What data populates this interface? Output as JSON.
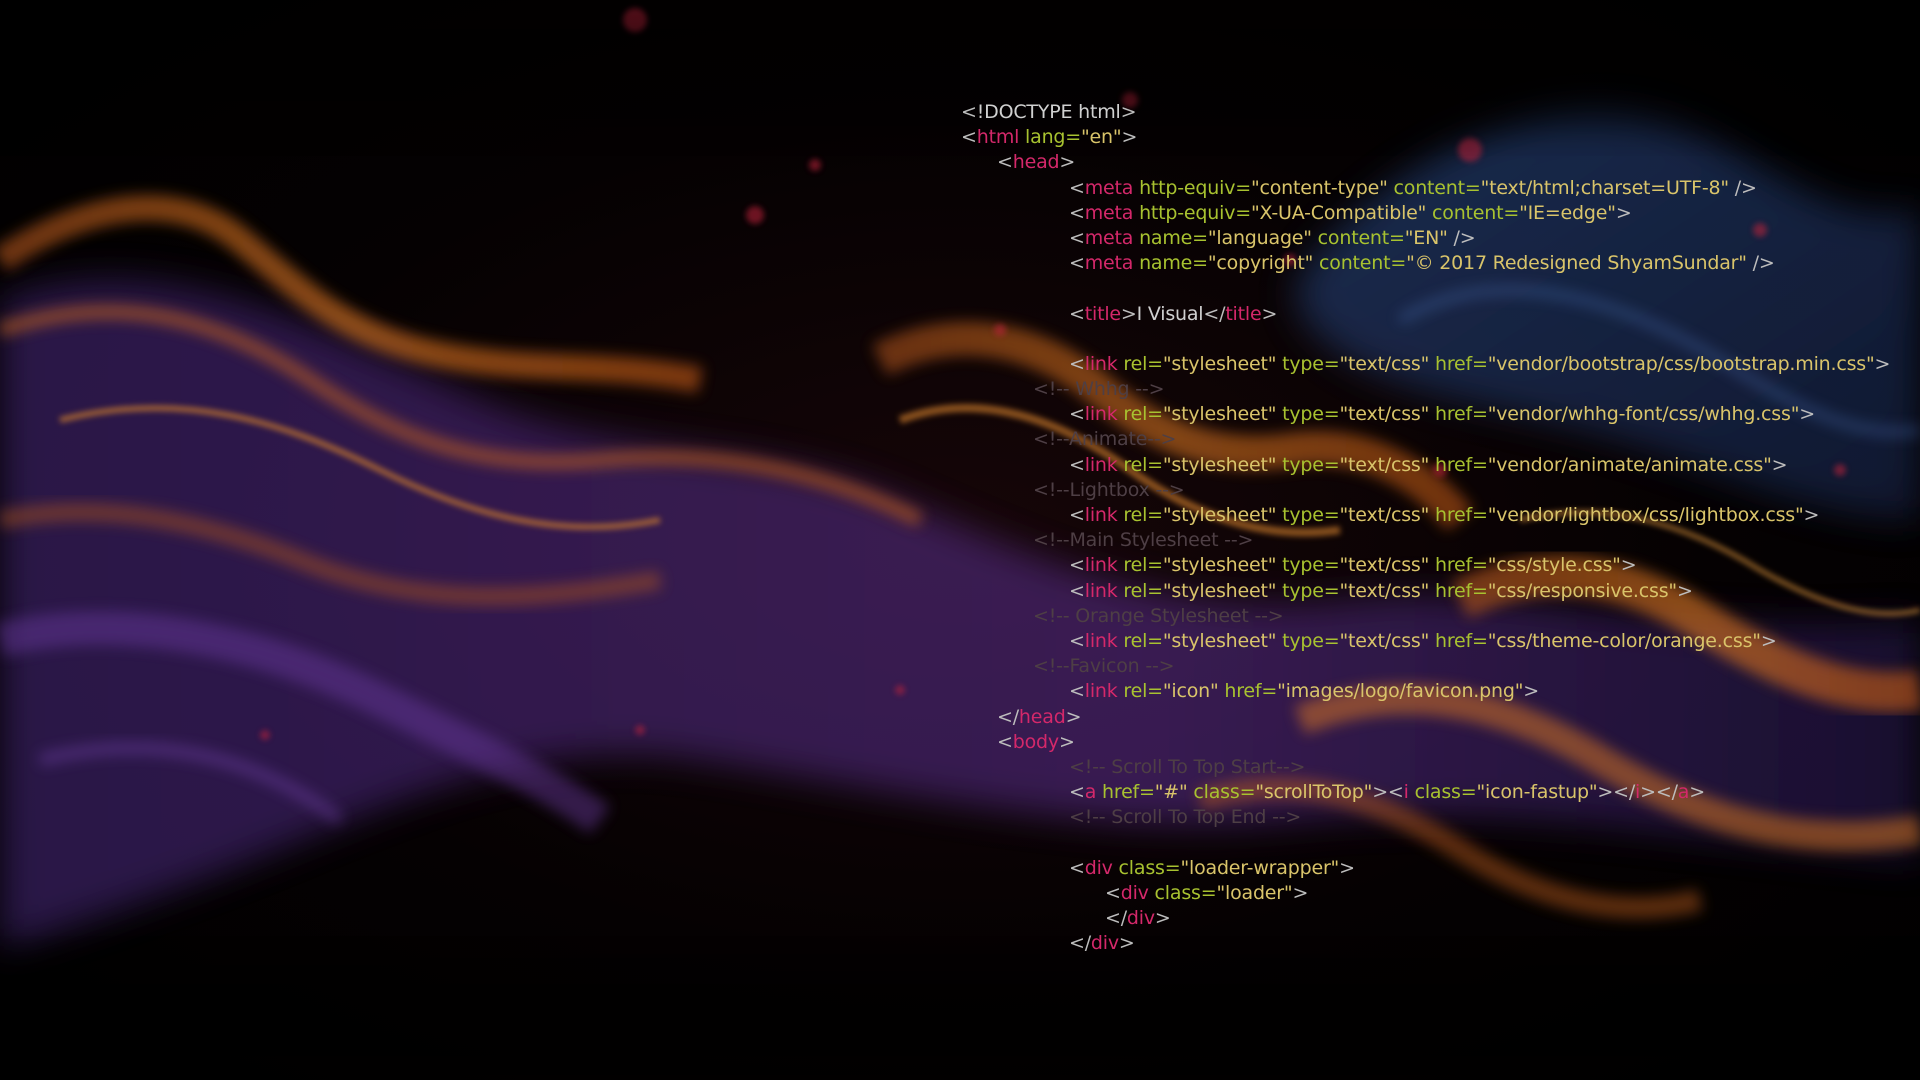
{
  "wallpaper": {
    "description_colors": {
      "background": "#000000",
      "flame_orange": "#e8731c",
      "flame_purple": "#5a2a8a",
      "smoke_blue": "#2c4a86",
      "ember_red": "#c0203a"
    }
  },
  "code": {
    "lines": [
      {
        "indent": 0,
        "tokens": [
          {
            "k": "bracket",
            "t": "<"
          },
          {
            "k": "text",
            "t": "!DOCTYPE html"
          },
          {
            "k": "bracket",
            "t": ">"
          }
        ]
      },
      {
        "indent": 0,
        "tokens": [
          {
            "k": "bracket",
            "t": "<"
          },
          {
            "k": "tag",
            "t": "html"
          },
          {
            "k": "attr",
            "t": " lang="
          },
          {
            "k": "value",
            "t": "\"en\""
          },
          {
            "k": "bracket",
            "t": ">"
          }
        ]
      },
      {
        "indent": 1,
        "tokens": [
          {
            "k": "bracket",
            "t": "<"
          },
          {
            "k": "tag",
            "t": "head"
          },
          {
            "k": "bracket",
            "t": ">"
          }
        ]
      },
      {
        "indent": 3,
        "tokens": [
          {
            "k": "bracket",
            "t": "<"
          },
          {
            "k": "tag",
            "t": "meta"
          },
          {
            "k": "attr",
            "t": " http-equiv="
          },
          {
            "k": "value",
            "t": "\"content-type\""
          },
          {
            "k": "attr",
            "t": " content="
          },
          {
            "k": "value",
            "t": "\"text/html;charset=UTF-8\""
          },
          {
            "k": "bracket",
            "t": " />"
          }
        ]
      },
      {
        "indent": 3,
        "tokens": [
          {
            "k": "bracket",
            "t": "<"
          },
          {
            "k": "tag",
            "t": "meta"
          },
          {
            "k": "attr",
            "t": " http-equiv="
          },
          {
            "k": "value",
            "t": "\"X-UA-Compatible\""
          },
          {
            "k": "attr",
            "t": " content="
          },
          {
            "k": "value",
            "t": "\"IE=edge\""
          },
          {
            "k": "bracket",
            "t": ">"
          }
        ]
      },
      {
        "indent": 3,
        "tokens": [
          {
            "k": "bracket",
            "t": "<"
          },
          {
            "k": "tag",
            "t": "meta"
          },
          {
            "k": "attr",
            "t": " name="
          },
          {
            "k": "value",
            "t": "\"language\""
          },
          {
            "k": "attr",
            "t": " content="
          },
          {
            "k": "value",
            "t": "\"EN\""
          },
          {
            "k": "bracket",
            "t": " />"
          }
        ]
      },
      {
        "indent": 3,
        "tokens": [
          {
            "k": "bracket",
            "t": "<"
          },
          {
            "k": "tag",
            "t": "meta"
          },
          {
            "k": "attr",
            "t": " name="
          },
          {
            "k": "value",
            "t": "\"copyright\""
          },
          {
            "k": "attr",
            "t": " content="
          },
          {
            "k": "value",
            "t": "\"© 2017 Redesigned ShyamSundar\""
          },
          {
            "k": "bracket",
            "t": " />"
          }
        ]
      },
      {
        "indent": 0,
        "tokens": []
      },
      {
        "indent": 3,
        "tokens": [
          {
            "k": "bracket",
            "t": "<"
          },
          {
            "k": "tag",
            "t": "title"
          },
          {
            "k": "bracket",
            "t": ">"
          },
          {
            "k": "text",
            "t": "I Visual"
          },
          {
            "k": "bracket",
            "t": "</"
          },
          {
            "k": "tag",
            "t": "title"
          },
          {
            "k": "bracket",
            "t": ">"
          }
        ]
      },
      {
        "indent": 0,
        "tokens": []
      },
      {
        "indent": 3,
        "tokens": [
          {
            "k": "bracket",
            "t": "<"
          },
          {
            "k": "tag",
            "t": "link"
          },
          {
            "k": "attr",
            "t": " rel="
          },
          {
            "k": "value",
            "t": "\"stylesheet\""
          },
          {
            "k": "attr",
            "t": " type="
          },
          {
            "k": "value",
            "t": "\"text/css\""
          },
          {
            "k": "attr",
            "t": " href="
          },
          {
            "k": "value",
            "t": "\"vendor/bootstrap/css/bootstrap.min.css\""
          },
          {
            "k": "bracket",
            "t": ">"
          }
        ]
      },
      {
        "indent": 2,
        "tokens": [
          {
            "k": "comment",
            "t": "<!-- Whhg -->"
          }
        ]
      },
      {
        "indent": 3,
        "tokens": [
          {
            "k": "bracket",
            "t": "<"
          },
          {
            "k": "tag",
            "t": "link"
          },
          {
            "k": "attr",
            "t": " rel="
          },
          {
            "k": "value",
            "t": "\"stylesheet\""
          },
          {
            "k": "attr",
            "t": " type="
          },
          {
            "k": "value",
            "t": "\"text/css\""
          },
          {
            "k": "attr",
            "t": " href="
          },
          {
            "k": "value",
            "t": "\"vendor/whhg-font/css/whhg.css\""
          },
          {
            "k": "bracket",
            "t": ">"
          }
        ]
      },
      {
        "indent": 2,
        "tokens": [
          {
            "k": "comment",
            "t": "<!--Animate-->"
          }
        ]
      },
      {
        "indent": 3,
        "tokens": [
          {
            "k": "bracket",
            "t": "<"
          },
          {
            "k": "tag",
            "t": "link"
          },
          {
            "k": "attr",
            "t": " rel="
          },
          {
            "k": "value",
            "t": "\"stylesheet\""
          },
          {
            "k": "attr",
            "t": " type="
          },
          {
            "k": "value",
            "t": "\"text/css\""
          },
          {
            "k": "attr",
            "t": " href="
          },
          {
            "k": "value",
            "t": "\"vendor/animate/animate.css\""
          },
          {
            "k": "bracket",
            "t": ">"
          }
        ]
      },
      {
        "indent": 2,
        "tokens": [
          {
            "k": "comment",
            "t": "<!--Lightbox -->"
          }
        ]
      },
      {
        "indent": 3,
        "tokens": [
          {
            "k": "bracket",
            "t": "<"
          },
          {
            "k": "tag",
            "t": "link"
          },
          {
            "k": "attr",
            "t": " rel="
          },
          {
            "k": "value",
            "t": "\"stylesheet\""
          },
          {
            "k": "attr",
            "t": " type="
          },
          {
            "k": "value",
            "t": "\"text/css\""
          },
          {
            "k": "attr",
            "t": " href="
          },
          {
            "k": "value",
            "t": "\"vendor/lightbox/css/lightbox.css\""
          },
          {
            "k": "bracket",
            "t": ">"
          }
        ]
      },
      {
        "indent": 2,
        "tokens": [
          {
            "k": "comment",
            "t": "<!--Main Stylesheet -->"
          }
        ]
      },
      {
        "indent": 3,
        "tokens": [
          {
            "k": "bracket",
            "t": "<"
          },
          {
            "k": "tag",
            "t": "link"
          },
          {
            "k": "attr",
            "t": " rel="
          },
          {
            "k": "value",
            "t": "\"stylesheet\""
          },
          {
            "k": "attr",
            "t": " type="
          },
          {
            "k": "value",
            "t": "\"text/css\""
          },
          {
            "k": "attr",
            "t": " href="
          },
          {
            "k": "value",
            "t": "\"css/style.css\""
          },
          {
            "k": "bracket",
            "t": ">"
          }
        ]
      },
      {
        "indent": 3,
        "tokens": [
          {
            "k": "bracket",
            "t": "<"
          },
          {
            "k": "tag",
            "t": "link"
          },
          {
            "k": "attr",
            "t": " rel="
          },
          {
            "k": "value",
            "t": "\"stylesheet\""
          },
          {
            "k": "attr",
            "t": " type="
          },
          {
            "k": "value",
            "t": "\"text/css\""
          },
          {
            "k": "attr",
            "t": " href="
          },
          {
            "k": "value",
            "t": "\"css/responsive.css\""
          },
          {
            "k": "bracket",
            "t": ">"
          }
        ]
      },
      {
        "indent": 2,
        "tokens": [
          {
            "k": "comment",
            "t": "<!-- Orange Stylesheet -->"
          }
        ]
      },
      {
        "indent": 3,
        "tokens": [
          {
            "k": "bracket",
            "t": "<"
          },
          {
            "k": "tag",
            "t": "link"
          },
          {
            "k": "attr",
            "t": " rel="
          },
          {
            "k": "value",
            "t": "\"stylesheet\""
          },
          {
            "k": "attr",
            "t": " type="
          },
          {
            "k": "value",
            "t": "\"text/css\""
          },
          {
            "k": "attr",
            "t": " href="
          },
          {
            "k": "value",
            "t": "\"css/theme-color/orange.css\""
          },
          {
            "k": "bracket",
            "t": ">"
          }
        ]
      },
      {
        "indent": 2,
        "tokens": [
          {
            "k": "comment",
            "t": "<!--Favicon -->"
          }
        ]
      },
      {
        "indent": 3,
        "tokens": [
          {
            "k": "bracket",
            "t": "<"
          },
          {
            "k": "tag",
            "t": "link"
          },
          {
            "k": "attr",
            "t": " rel="
          },
          {
            "k": "value",
            "t": "\"icon\""
          },
          {
            "k": "attr",
            "t": " href="
          },
          {
            "k": "value",
            "t": "\"images/logo/favicon.png\""
          },
          {
            "k": "bracket",
            "t": ">"
          }
        ]
      },
      {
        "indent": 1,
        "tokens": [
          {
            "k": "bracket",
            "t": "</"
          },
          {
            "k": "tag",
            "t": "head"
          },
          {
            "k": "bracket",
            "t": ">"
          }
        ]
      },
      {
        "indent": 1,
        "tokens": [
          {
            "k": "bracket",
            "t": "<"
          },
          {
            "k": "tag",
            "t": "body"
          },
          {
            "k": "bracket",
            "t": ">"
          }
        ]
      },
      {
        "indent": 3,
        "tokens": [
          {
            "k": "comment",
            "t": "<!-- Scroll To Top Start-->"
          }
        ]
      },
      {
        "indent": 3,
        "tokens": [
          {
            "k": "bracket",
            "t": "<"
          },
          {
            "k": "tag",
            "t": "a"
          },
          {
            "k": "attr",
            "t": " href="
          },
          {
            "k": "value",
            "t": "\"#\""
          },
          {
            "k": "attr",
            "t": " class="
          },
          {
            "k": "value",
            "t": "\"scrollToTop\""
          },
          {
            "k": "bracket",
            "t": "><"
          },
          {
            "k": "tag",
            "t": "i"
          },
          {
            "k": "attr",
            "t": " class="
          },
          {
            "k": "value",
            "t": "\"icon-fastup\""
          },
          {
            "k": "bracket",
            "t": "></"
          },
          {
            "k": "tag",
            "t": "i"
          },
          {
            "k": "bracket",
            "t": "></"
          },
          {
            "k": "tag",
            "t": "a"
          },
          {
            "k": "bracket",
            "t": ">"
          }
        ]
      },
      {
        "indent": 3,
        "tokens": [
          {
            "k": "comment",
            "t": "<!-- Scroll To Top End -->"
          }
        ]
      },
      {
        "indent": 0,
        "tokens": []
      },
      {
        "indent": 3,
        "tokens": [
          {
            "k": "bracket",
            "t": "<"
          },
          {
            "k": "tag",
            "t": "div"
          },
          {
            "k": "attr",
            "t": " class="
          },
          {
            "k": "value",
            "t": "\"loader-wrapper\""
          },
          {
            "k": "bracket",
            "t": ">"
          }
        ]
      },
      {
        "indent": 4,
        "tokens": [
          {
            "k": "bracket",
            "t": "<"
          },
          {
            "k": "tag",
            "t": "div"
          },
          {
            "k": "attr",
            "t": " class="
          },
          {
            "k": "value",
            "t": "\"loader\""
          },
          {
            "k": "bracket",
            "t": ">"
          }
        ]
      },
      {
        "indent": 4,
        "tokens": [
          {
            "k": "bracket",
            "t": "</"
          },
          {
            "k": "tag",
            "t": "div"
          },
          {
            "k": "bracket",
            "t": ">"
          }
        ]
      },
      {
        "indent": 3,
        "tokens": [
          {
            "k": "bracket",
            "t": "</"
          },
          {
            "k": "tag",
            "t": "div"
          },
          {
            "k": "bracket",
            "t": ">"
          }
        ]
      }
    ]
  }
}
